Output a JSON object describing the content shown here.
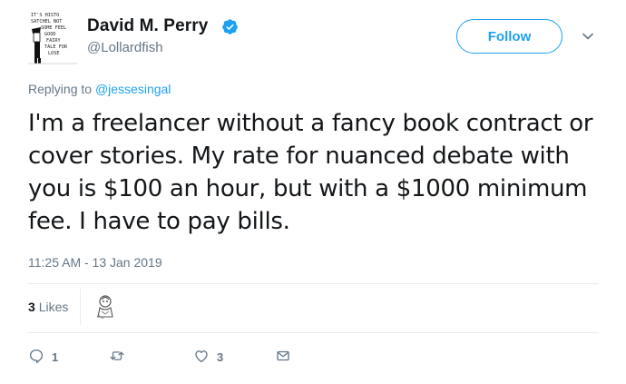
{
  "author": {
    "name": "David M. Perry",
    "handle": "@Lollardfish",
    "avatar_text": "IT'S HISTORY SATCHEL NOT SOME FEEL GOOD FAIRY TALE FOR LOSERS"
  },
  "follow_label": "Follow",
  "reply_context": {
    "prefix": "Replying to",
    "mention": "@jessesingal"
  },
  "tweet": {
    "text": "I'm a freelancer without a fancy book contract or cover stories. My rate for nuanced debate with you is $100 an hour, but with a $1000 minimum fee. I have to pay bills.",
    "timestamp": "11:25 AM - 13 Jan 2019"
  },
  "stats": {
    "likes_count": "3",
    "likes_label": "Likes"
  },
  "actions": {
    "reply_count": "1",
    "retweet_count": "",
    "like_count": "3"
  },
  "colors": {
    "accent": "#1da1f2",
    "muted": "#657786",
    "text": "#14171a",
    "divider": "#e6ecf0"
  },
  "icons": [
    "verified-badge-icon",
    "chevron-down-icon",
    "reply-icon",
    "retweet-icon",
    "heart-icon",
    "envelope-icon"
  ]
}
